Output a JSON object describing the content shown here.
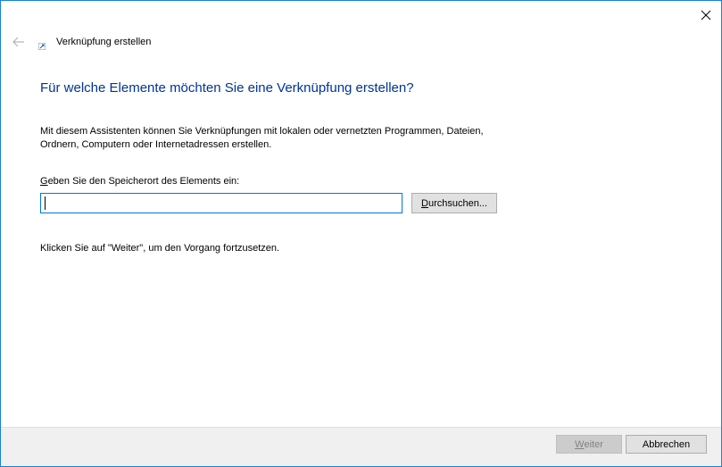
{
  "window": {
    "accent_color": "#1883d7",
    "close_icon": "close-icon"
  },
  "header": {
    "back_icon": "back-arrow-icon",
    "app_icon": "shortcut-icon",
    "title": "Verknüpfung erstellen"
  },
  "main": {
    "heading": "Für welche Elemente möchten Sie eine Verknüpfung erstellen?",
    "heading_color": "#003399",
    "description_line1": "Mit diesem Assistenten können Sie Verknüpfungen mit lokalen oder vernetzten Programmen, Dateien,",
    "description_line2": "Ordnern, Computern oder Internetadressen erstellen.",
    "location_label_mnemonic": "G",
    "location_label_rest": "eben Sie den Speicherort des Elements ein:",
    "location_value": "",
    "browse_mnemonic": "D",
    "browse_rest": "urchsuchen...",
    "hint": "Klicken Sie auf \"Weiter\", um den Vorgang fortzusetzen."
  },
  "footer": {
    "next_mnemonic": "W",
    "next_rest": "eiter",
    "next_disabled": true,
    "cancel_label": "Abbrechen"
  }
}
